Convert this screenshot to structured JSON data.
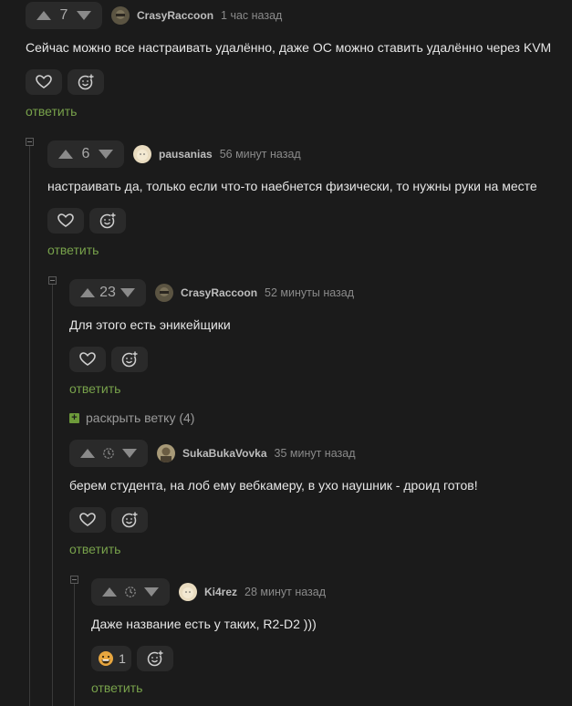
{
  "comments": [
    {
      "rating": "7",
      "author": "CrasyRaccoon",
      "time": "1 час назад",
      "text": "Сейчас можно все настраивать удалённо, даже ОС можно ставить удалённо через KVM",
      "reply": "ответить"
    },
    {
      "rating": "6",
      "author": "pausanias",
      "time": "56 минут назад",
      "text": "настраивать да, только если что-то наебнется физически, то нужны руки на месте",
      "reply": "ответить"
    },
    {
      "rating": "23",
      "author": "CrasyRaccoon",
      "time": "52 минуты назад",
      "text": "Для этого есть эникейщики",
      "reply": "ответить"
    },
    {
      "author": "SukaBukaVovka",
      "time": "35 минут назад",
      "text": "берем студента, на лоб ему вебкамеру, в ухо наушник - дроид готов!",
      "reply": "ответить"
    },
    {
      "author": "Ki4rez",
      "time": "28 минут назад",
      "text": "Даже название есть у таких, R2-D2 )))",
      "reaction_count": "1",
      "reply": "ответить"
    }
  ],
  "expand_thread": "раскрыть ветку (4)",
  "colors": {
    "background": "#1b1b1b",
    "button_bg": "#2a2a2a",
    "reply_link": "#78a24b",
    "expand_plus": "#6d9a3a"
  }
}
